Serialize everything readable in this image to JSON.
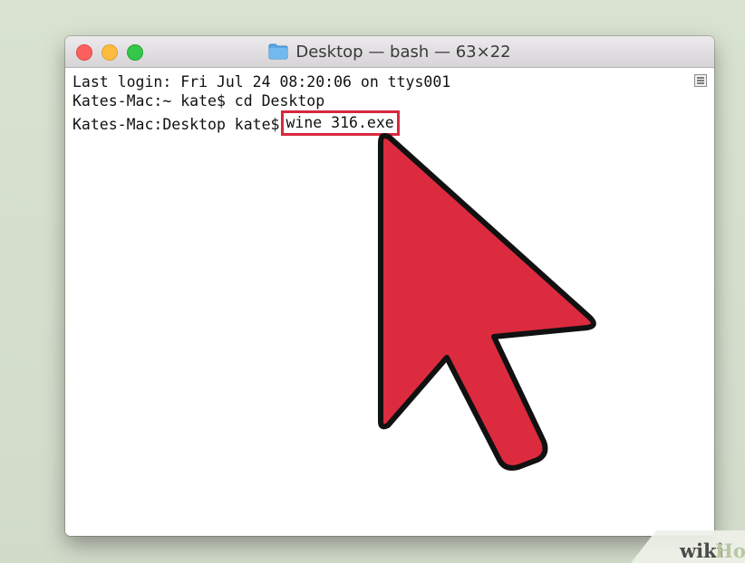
{
  "window": {
    "title": "Desktop — bash — 63×22"
  },
  "terminal": {
    "lines": [
      "Last login: Fri Jul 24 08:20:06 on ttys001",
      "Kates-Mac:~ kate$ cd Desktop"
    ],
    "prompt": "Kates-Mac:Desktop kate$",
    "highlighted_command": "wine 316.exe"
  },
  "icons": {
    "folder": "folder-icon",
    "scroll": "scroll-indicator-icon",
    "arrow": "cursor-arrow-icon"
  },
  "colors": {
    "highlight_box": "#d8283f",
    "arrow_fill": "#dc2b3e",
    "close": "#fc605c",
    "minimize": "#fdbc40",
    "zoom": "#34c749"
  },
  "watermark": {
    "text_wiki": "wiki",
    "text_how": "How"
  }
}
